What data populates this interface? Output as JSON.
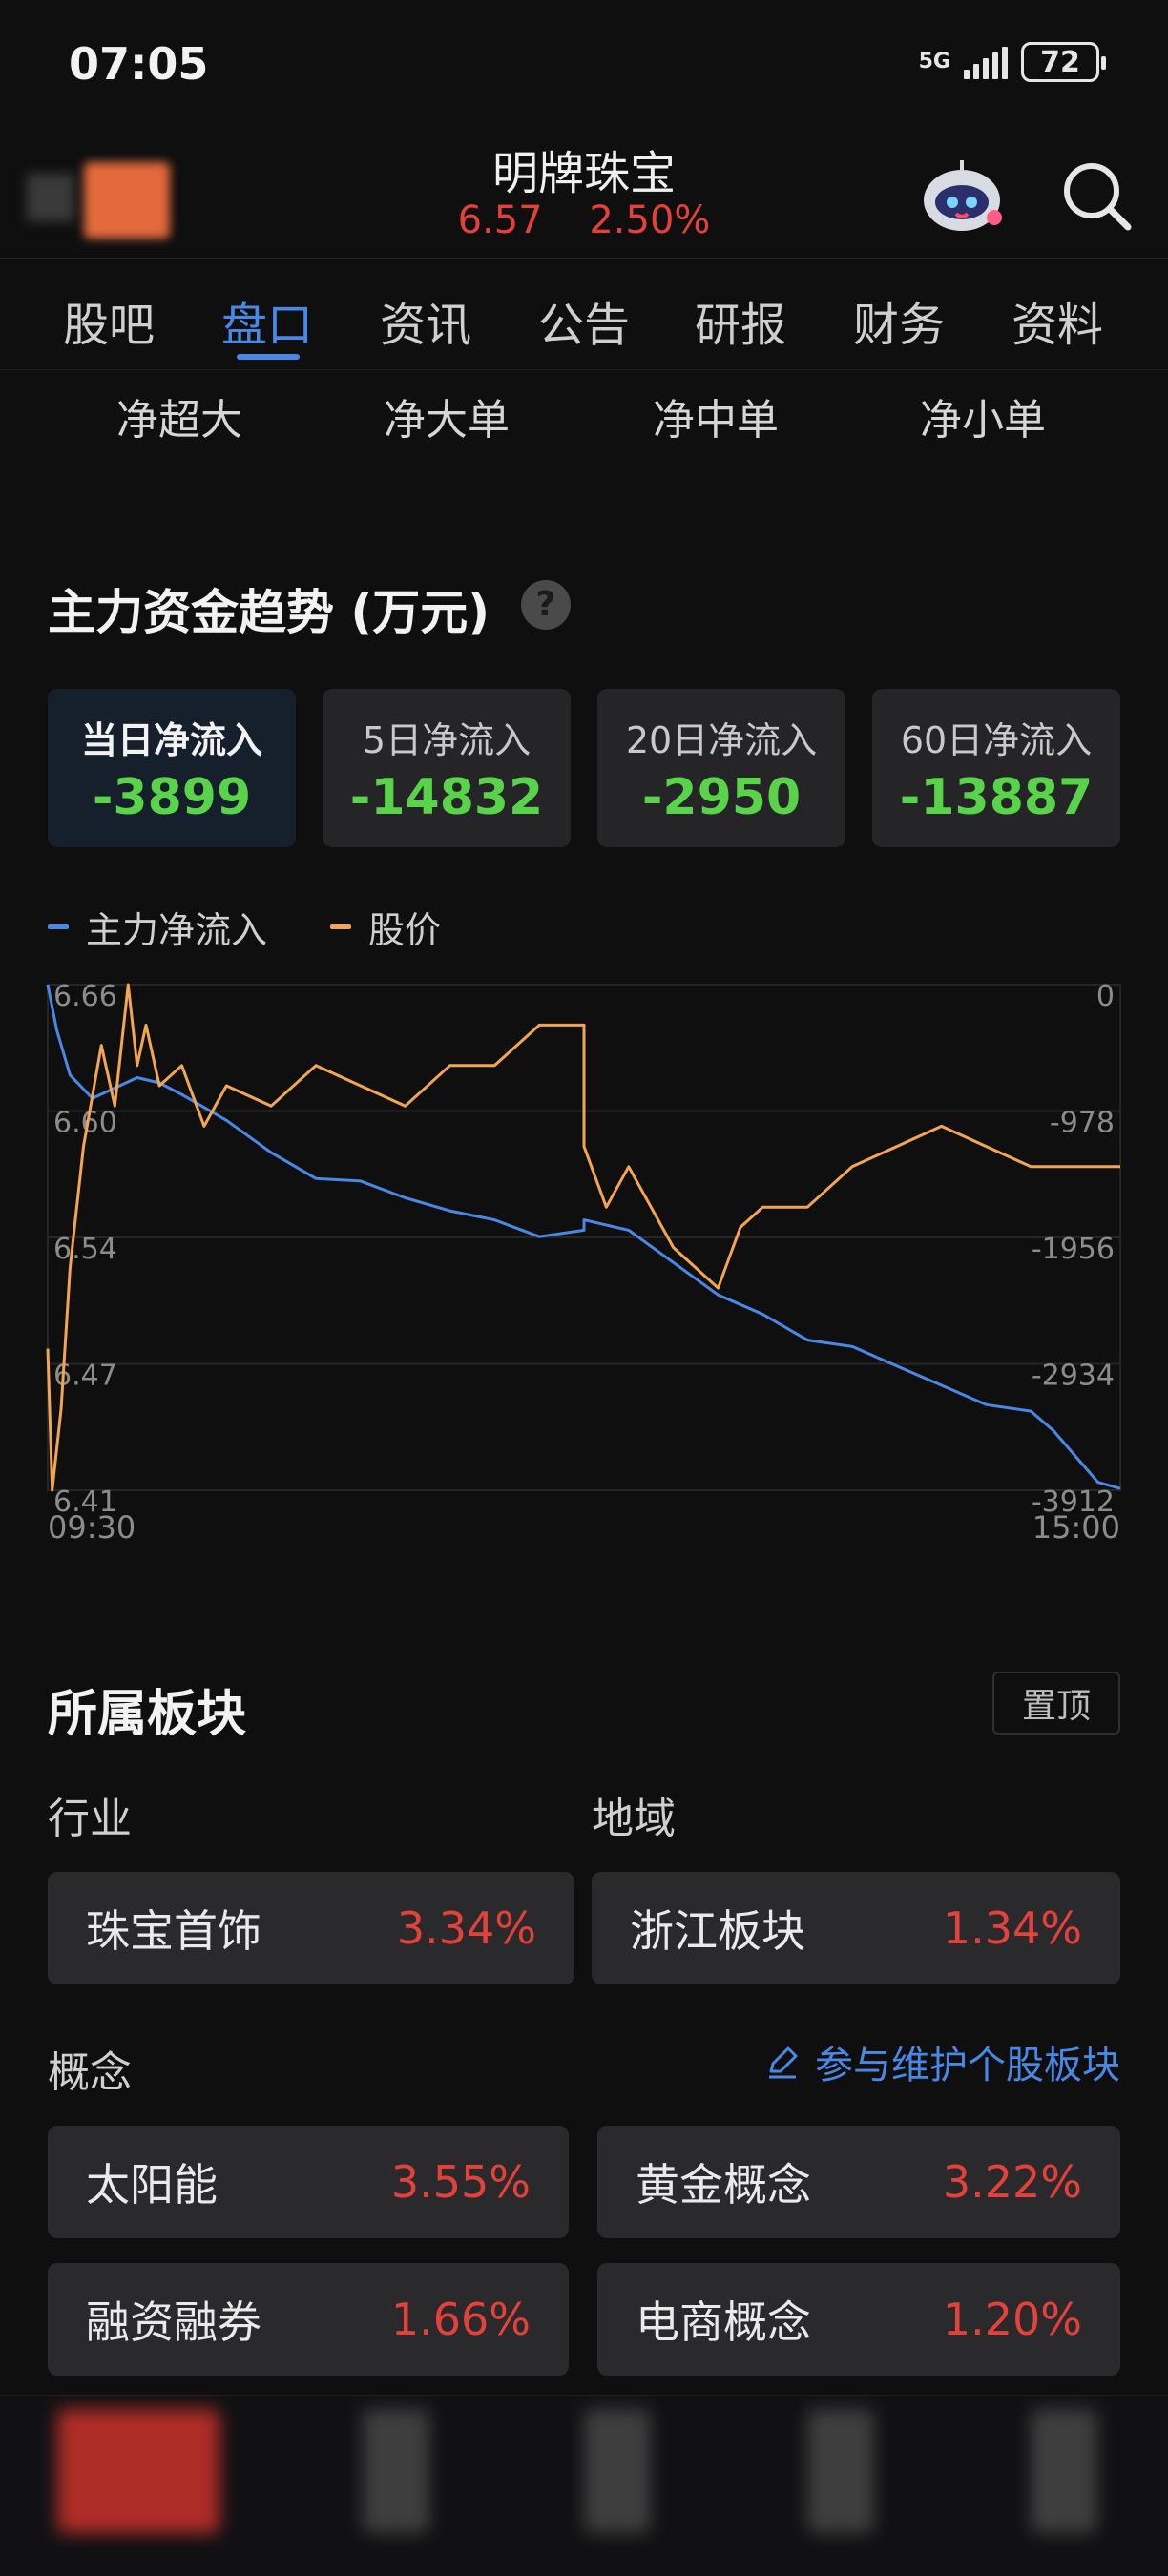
{
  "status_bar": {
    "time": "07:05",
    "network": "5G",
    "battery": "72"
  },
  "header": {
    "title": "明牌珠宝",
    "price": "6.57",
    "change_pct": "2.50%"
  },
  "tabs": [
    {
      "label": "股吧",
      "active": false
    },
    {
      "label": "盘口",
      "active": true
    },
    {
      "label": "资讯",
      "active": false
    },
    {
      "label": "公告",
      "active": false
    },
    {
      "label": "研报",
      "active": false
    },
    {
      "label": "财务",
      "active": false
    },
    {
      "label": "资料",
      "active": false
    }
  ],
  "order_tabs": [
    "净超大",
    "净大单",
    "净中单",
    "净小单"
  ],
  "capital_trend": {
    "title": "主力资金趋势 (万元)",
    "help": "?",
    "cards": [
      {
        "label": "当日净流入",
        "value": "-3899",
        "active": true
      },
      {
        "label": "5日净流入",
        "value": "-14832",
        "active": false
      },
      {
        "label": "20日净流入",
        "value": "-2950",
        "active": false
      },
      {
        "label": "60日净流入",
        "value": "-13887",
        "active": false
      }
    ]
  },
  "chart_data": {
    "type": "line",
    "legend_position": "top-left",
    "x_start_label": "09:30",
    "x_end_label": "15:00",
    "x_range": [
      "09:30",
      "15:00"
    ],
    "grid": true,
    "left_axis": {
      "ticks": [
        "6.66",
        "6.60",
        "6.54",
        "6.47",
        "6.41"
      ],
      "range": [
        6.41,
        6.66
      ]
    },
    "right_axis": {
      "ticks": [
        "0",
        "-978",
        "-1956",
        "-2934",
        "-3912"
      ],
      "range": [
        -3912,
        0
      ]
    },
    "series": [
      {
        "name": "主力净流入",
        "color": "#4a88e6",
        "axis": "right",
        "x": [
          "09:30",
          "09:32",
          "09:35",
          "09:40",
          "09:45",
          "09:50",
          "09:55",
          "10:00",
          "10:10",
          "10:20",
          "10:30",
          "10:40",
          "10:50",
          "11:00",
          "11:10",
          "11:20",
          "11:30",
          "13:00",
          "13:10",
          "13:20",
          "13:30",
          "13:40",
          "13:50",
          "14:00",
          "14:10",
          "14:20",
          "14:30",
          "14:40",
          "14:45",
          "14:50",
          "14:55",
          "15:00"
        ],
        "values": [
          0,
          -350,
          -700,
          -880,
          -800,
          -720,
          -760,
          -850,
          -1050,
          -1300,
          -1500,
          -1520,
          -1650,
          -1750,
          -1820,
          -1950,
          -1900,
          -1820,
          -1900,
          -2150,
          -2400,
          -2550,
          -2750,
          -2800,
          -2950,
          -3100,
          -3250,
          -3300,
          -3450,
          -3650,
          -3850,
          -3899
        ]
      },
      {
        "name": "股价",
        "color": "#f2a652",
        "axis": "left",
        "x": [
          "09:30",
          "09:31",
          "09:33",
          "09:35",
          "09:38",
          "09:42",
          "09:45",
          "09:48",
          "09:50",
          "09:52",
          "09:55",
          "10:00",
          "10:05",
          "10:10",
          "10:20",
          "10:30",
          "10:40",
          "10:50",
          "11:00",
          "11:10",
          "11:20",
          "11:25",
          "11:30",
          "13:00",
          "13:05",
          "13:10",
          "13:20",
          "13:30",
          "13:35",
          "13:40",
          "13:50",
          "14:00",
          "14:10",
          "14:20",
          "14:30",
          "14:40",
          "14:50",
          "15:00"
        ],
        "values": [
          6.48,
          6.41,
          6.45,
          6.52,
          6.58,
          6.63,
          6.6,
          6.66,
          6.62,
          6.64,
          6.61,
          6.62,
          6.59,
          6.61,
          6.6,
          6.62,
          6.61,
          6.6,
          6.62,
          6.62,
          6.64,
          6.64,
          6.64,
          6.58,
          6.55,
          6.57,
          6.53,
          6.51,
          6.54,
          6.55,
          6.55,
          6.57,
          6.58,
          6.59,
          6.58,
          6.57,
          6.57,
          6.57
        ]
      }
    ]
  },
  "sectors": {
    "title": "所属板块",
    "pin_label": "置顶",
    "industry_label": "行业",
    "region_label": "地域",
    "concept_label": "概念",
    "maintain_link": "参与维护个股板块",
    "industry": {
      "name": "珠宝首饰",
      "pct": "3.34%"
    },
    "region": {
      "name": "浙江板块",
      "pct": "1.34%"
    },
    "concepts": [
      {
        "name": "太阳能",
        "pct": "3.55%"
      },
      {
        "name": "黄金概念",
        "pct": "3.22%"
      },
      {
        "name": "融资融券",
        "pct": "1.66%"
      },
      {
        "name": "电商概念",
        "pct": "1.20%"
      }
    ]
  },
  "colors": {
    "accent": "#4a88e6",
    "up": "#e5413b",
    "down": "#58d34a",
    "price_line": "#f2a652"
  }
}
